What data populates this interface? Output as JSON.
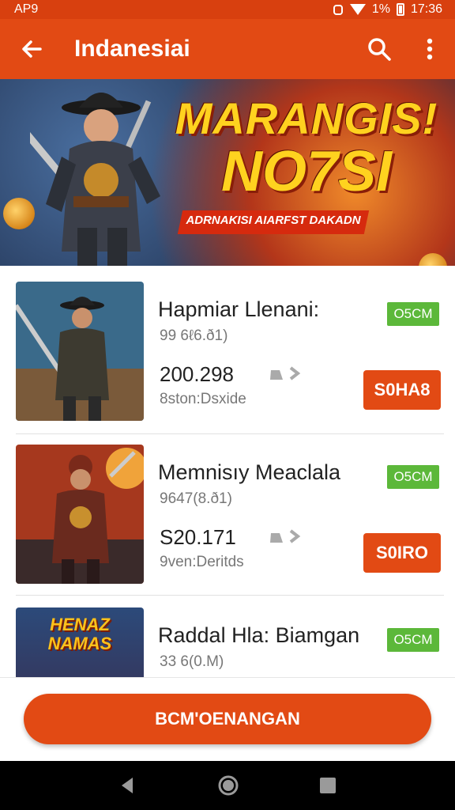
{
  "status": {
    "carrier": "AP9",
    "battery": "1%",
    "time": "17:36"
  },
  "appbar": {
    "title": "Indanesiai"
  },
  "banner": {
    "line1": "MARANGIS!",
    "line2": "NO7SI",
    "ribbon": "ADRNAKISI AIARFST DAKADN"
  },
  "items": [
    {
      "name": "Hapmiar Llenani:",
      "sub": "99 6ℓ6.ð1)",
      "price": "200.298",
      "meta": "8ston:Dsxide",
      "badge": "O5CM",
      "button": "S0HA8"
    },
    {
      "name": "Memnisıy Meaclala",
      "sub": "9647(8.ð1)",
      "price": "S20.171",
      "meta": "9ven:Deritds",
      "badge": "O5CM",
      "button": "S0IRO"
    },
    {
      "name": "Raddal Hla: Biamgan",
      "sub": "33 6(0.M)",
      "badge": "O5CM",
      "thumb_text": "HENAZ NAMAS"
    }
  ],
  "cta": {
    "label": "BCM'OENANGAN"
  },
  "colors": {
    "primary": "#e24a14",
    "badge": "#5cb83a",
    "banner_text": "#ffd21f"
  },
  "icons": [
    "back-arrow-icon",
    "search-icon",
    "more-vert-icon",
    "wifi-icon",
    "battery-icon",
    "nav-back-icon",
    "nav-home-icon",
    "nav-recents-icon"
  ]
}
